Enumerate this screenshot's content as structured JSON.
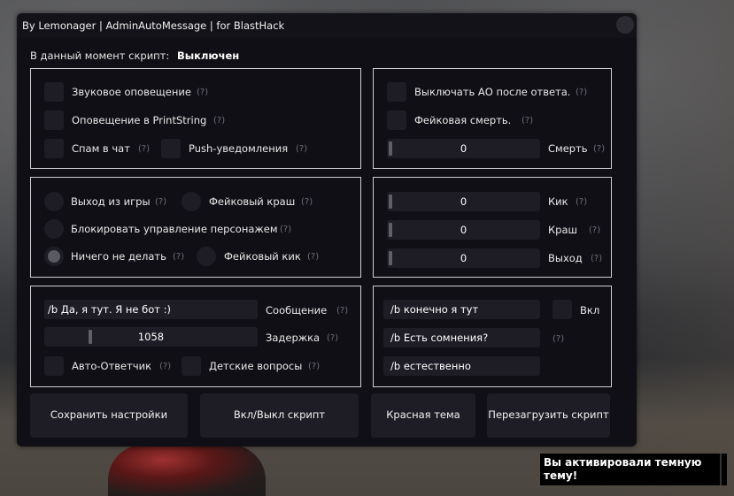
{
  "window": {
    "title": "By Lemonager | AdminAutoMessage | for BlastHack"
  },
  "status": {
    "label": "В данный момент скрипт:",
    "value": "Выключен"
  },
  "help_glyph": "(?)",
  "panel1": {
    "sound_alert": "Звуковое оповещение",
    "printstring_alert": "Оповещение в PrintString",
    "chat_spam": "Спам в чат",
    "push": "Push-уведомления"
  },
  "panel2": {
    "disable_ao": "Выключать АО после ответа.",
    "fake_death": "Фейковая смерть.",
    "death_value": "0",
    "death_label": "Смерть"
  },
  "panel3": {
    "exit_game": "Выход из игры",
    "fake_crash": "Фейковый краш",
    "block_control": "Блокировать управление персонажем",
    "do_nothing": "Ничего не делать",
    "fake_kick": "Фейковый кик",
    "selected_option": "Ничего не делать"
  },
  "panel4": {
    "kick_value": "0",
    "kick_label": "Кик",
    "crash_value": "0",
    "crash_label": "Краш",
    "exit_value": "0",
    "exit_label": "Выход"
  },
  "panel5": {
    "message_value": "/b Да, я тут. Я не бот :)",
    "message_label": "Сообщение",
    "delay_value": "1058",
    "delay_label": "Задержка",
    "auto_answer": "Авто-Ответчик",
    "kids_questions": "Детские вопросы"
  },
  "panel6": {
    "answer1": "/b конечно я тут",
    "enable_label": "Вкл",
    "answer2": "/b Есть сомнения?",
    "answer3": "/b естественно"
  },
  "buttons": {
    "save": "Сохранить настройки",
    "toggle": "Вкл/Выкл скрипт",
    "red_theme": "Красная тема",
    "reload": "Перезагрузить скрипт"
  },
  "notification": {
    "text": "Вы активировали темную тему!"
  }
}
